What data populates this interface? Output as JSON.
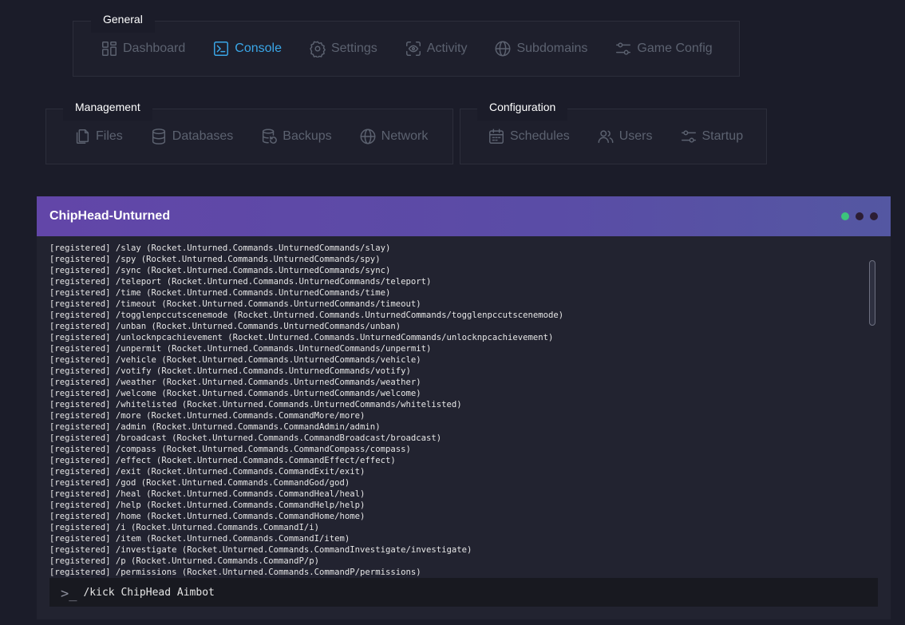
{
  "general": {
    "title": "General",
    "items": [
      {
        "label": "Dashboard",
        "icon": "dashboard-icon"
      },
      {
        "label": "Console",
        "icon": "console-icon",
        "active": true
      },
      {
        "label": "Settings",
        "icon": "gear-icon"
      },
      {
        "label": "Activity",
        "icon": "activity-icon"
      },
      {
        "label": "Subdomains",
        "icon": "globe-icon"
      },
      {
        "label": "Game Config",
        "icon": "sliders-icon"
      }
    ]
  },
  "management": {
    "title": "Management",
    "items": [
      {
        "label": "Files",
        "icon": "files-icon"
      },
      {
        "label": "Databases",
        "icon": "database-icon"
      },
      {
        "label": "Backups",
        "icon": "backup-icon"
      },
      {
        "label": "Network",
        "icon": "globe-icon"
      }
    ]
  },
  "configuration": {
    "title": "Configuration",
    "items": [
      {
        "label": "Schedules",
        "icon": "calendar-icon"
      },
      {
        "label": "Users",
        "icon": "users-icon"
      },
      {
        "label": "Startup",
        "icon": "sliders-icon"
      }
    ]
  },
  "console": {
    "title": "ChipHead-Unturned",
    "lines": [
      "[registered] /slay (Rocket.Unturned.Commands.UnturnedCommands/slay)",
      "[registered] /spy (Rocket.Unturned.Commands.UnturnedCommands/spy)",
      "[registered] /sync (Rocket.Unturned.Commands.UnturnedCommands/sync)",
      "[registered] /teleport (Rocket.Unturned.Commands.UnturnedCommands/teleport)",
      "[registered] /time (Rocket.Unturned.Commands.UnturnedCommands/time)",
      "[registered] /timeout (Rocket.Unturned.Commands.UnturnedCommands/timeout)",
      "[registered] /togglenpccutscenemode (Rocket.Unturned.Commands.UnturnedCommands/togglenpccutscenemode)",
      "[registered] /unban (Rocket.Unturned.Commands.UnturnedCommands/unban)",
      "[registered] /unlocknpcachievement (Rocket.Unturned.Commands.UnturnedCommands/unlocknpcachievement)",
      "[registered] /unpermit (Rocket.Unturned.Commands.UnturnedCommands/unpermit)",
      "[registered] /vehicle (Rocket.Unturned.Commands.UnturnedCommands/vehicle)",
      "[registered] /votify (Rocket.Unturned.Commands.UnturnedCommands/votify)",
      "[registered] /weather (Rocket.Unturned.Commands.UnturnedCommands/weather)",
      "[registered] /welcome (Rocket.Unturned.Commands.UnturnedCommands/welcome)",
      "[registered] /whitelisted (Rocket.Unturned.Commands.UnturnedCommands/whitelisted)",
      "[registered] /more (Rocket.Unturned.Commands.CommandMore/more)",
      "[registered] /admin (Rocket.Unturned.Commands.CommandAdmin/admin)",
      "[registered] /broadcast (Rocket.Unturned.Commands.CommandBroadcast/broadcast)",
      "[registered] /compass (Rocket.Unturned.Commands.CommandCompass/compass)",
      "[registered] /effect (Rocket.Unturned.Commands.CommandEffect/effect)",
      "[registered] /exit (Rocket.Unturned.Commands.CommandExit/exit)",
      "[registered] /god (Rocket.Unturned.Commands.CommandGod/god)",
      "[registered] /heal (Rocket.Unturned.Commands.CommandHeal/heal)",
      "[registered] /help (Rocket.Unturned.Commands.CommandHelp/help)",
      "[registered] /home (Rocket.Unturned.Commands.CommandHome/home)",
      "[registered] /i (Rocket.Unturned.Commands.CommandI/i)",
      "[registered] /item (Rocket.Unturned.Commands.CommandI/item)",
      "[registered] /investigate (Rocket.Unturned.Commands.CommandInvestigate/investigate)",
      "[registered] /p (Rocket.Unturned.Commands.CommandP/p)",
      "[registered] /permissions (Rocket.Unturned.Commands.CommandP/permissions)"
    ],
    "command_value": "/kick ChipHead Aimbot",
    "prompt": ">_"
  },
  "colors": {
    "accent": "#3aa7e8",
    "header_start": "#6246a8",
    "header_end": "#5457a2",
    "status_online": "#3cc47c"
  }
}
